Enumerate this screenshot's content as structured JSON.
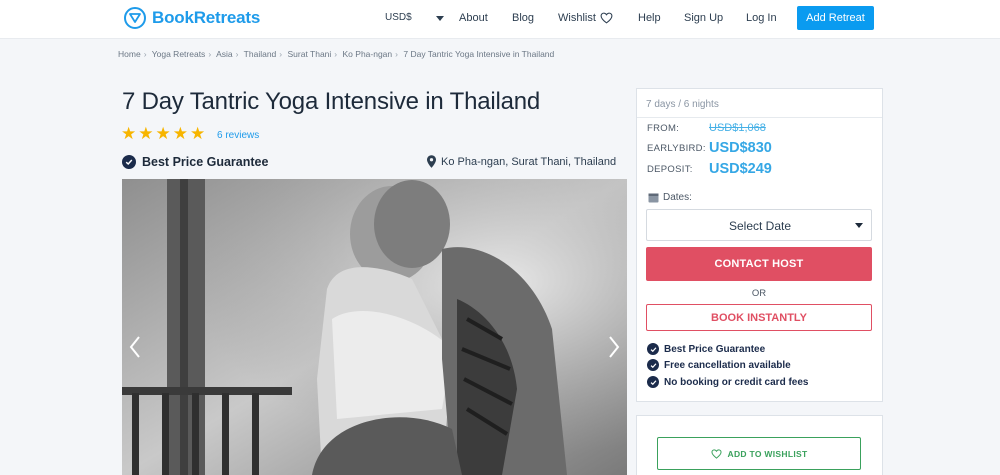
{
  "header": {
    "brand": "BookRetreats",
    "currency": "USD$",
    "nav": [
      {
        "label": "About"
      },
      {
        "label": "Blog"
      },
      {
        "label": "Wishlist"
      },
      {
        "label": "Help"
      },
      {
        "label": "Sign Up"
      },
      {
        "label": "Log In"
      }
    ],
    "cta": "Add Retreat"
  },
  "breadcrumb": [
    "Home",
    "Yoga Retreats",
    "Asia",
    "Thailand",
    "Surat Thani",
    "Ko Pha-ngan",
    "7 Day Tantric Yoga Intensive in Thailand"
  ],
  "listing": {
    "title": "7 Day Tantric Yoga Intensive in Thailand",
    "rating_stars": 5,
    "reviews": "6 reviews",
    "guarantee": "Best Price Guarantee",
    "location": "Ko Pha-ngan, Surat Thani, Thailand"
  },
  "booking": {
    "duration": "7 days / 6 nights",
    "from_label": "FROM:",
    "from_price": "USD$1,068",
    "earlybird_label": "EARLYBIRD:",
    "earlybird_price": "USD$830",
    "deposit_label": "DEPOSIT:",
    "deposit_price": "USD$249",
    "dates_label": "Dates:",
    "select_placeholder": "Select Date",
    "contact": "CONTACT HOST",
    "or": "OR",
    "book": "BOOK INSTANTLY",
    "features": [
      "Best Price Guarantee",
      "Free cancellation available",
      "No booking or credit card fees"
    ]
  },
  "wishlist": {
    "label": "ADD TO WISHLIST"
  },
  "colors": {
    "brand": "#1e9bea",
    "cta_blue": "#0a9bf0",
    "contact_red": "#e04f63",
    "price_blue": "#35a7e5",
    "star": "#f7b500",
    "wishlist_green": "#3aa15c"
  },
  "icons": [
    "logo-icon",
    "chevron-down-icon",
    "heart-icon",
    "star-icon",
    "check-circle-icon",
    "map-pin-icon",
    "chevron-left-icon",
    "chevron-right-icon",
    "calendar-icon"
  ]
}
